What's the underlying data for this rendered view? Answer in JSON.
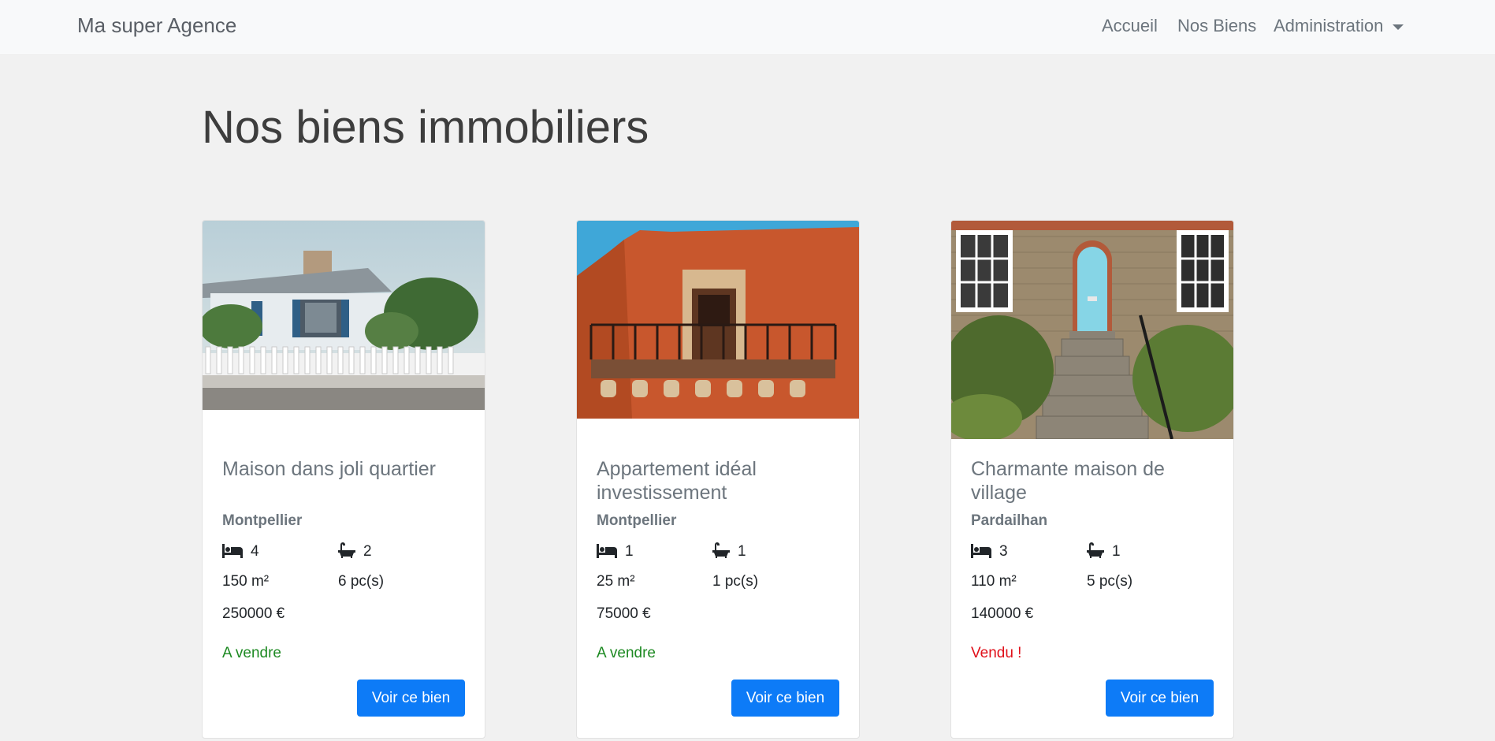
{
  "navbar": {
    "brand": "Ma super Agence",
    "links": [
      {
        "label": "Accueil"
      },
      {
        "label": "Nos Biens"
      },
      {
        "label": "Administration"
      }
    ]
  },
  "page": {
    "title": "Nos biens immobiliers"
  },
  "colors": {
    "accent": "#0d7bf7",
    "status_available": "#1e8a23",
    "status_sold": "#e0101a"
  },
  "properties": [
    {
      "title": "Maison dans joli quartier",
      "city": "Montpellier",
      "bedrooms": "4",
      "bathrooms": "2",
      "surface": "150 m²",
      "rooms": "6 pc(s)",
      "price": "250000 €",
      "status": "A vendre",
      "status_type": "available",
      "button_label": "Voir ce bien",
      "icons": {
        "bedrooms": "bed-icon",
        "bathrooms": "bath-icon"
      }
    },
    {
      "title": "Appartement idéal investissement",
      "city": "Montpellier",
      "bedrooms": "1",
      "bathrooms": "1",
      "surface": "25 m²",
      "rooms": "1 pc(s)",
      "price": "75000 €",
      "status": "A vendre",
      "status_type": "available",
      "button_label": "Voir ce bien",
      "icons": {
        "bedrooms": "bed-icon",
        "bathrooms": "bath-icon"
      }
    },
    {
      "title": "Charmante maison de village",
      "city": "Pardailhan",
      "bedrooms": "3",
      "bathrooms": "1",
      "surface": "110 m²",
      "rooms": "5 pc(s)",
      "price": "140000 €",
      "status": "Vendu !",
      "status_type": "sold",
      "button_label": "Voir ce bien",
      "icons": {
        "bedrooms": "bed-icon",
        "bathrooms": "bath-icon"
      }
    }
  ]
}
